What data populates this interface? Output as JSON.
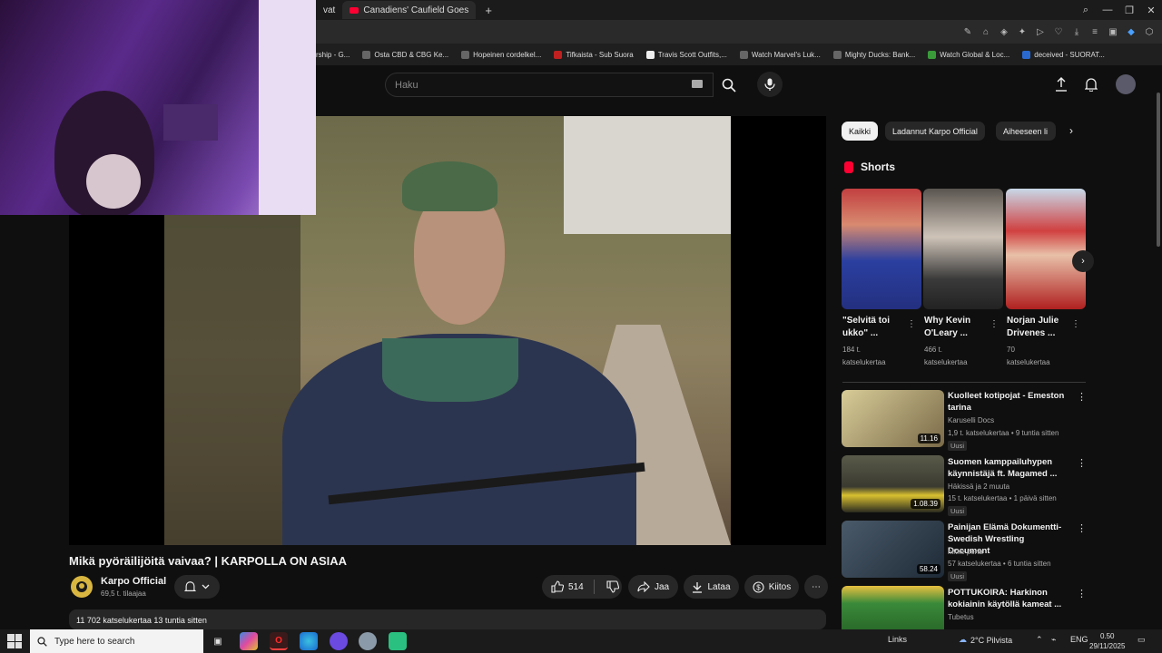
{
  "browser": {
    "tabs": [
      {
        "label": "vat"
      },
      {
        "label": "Canadiens' Caufield Goes"
      }
    ],
    "bookmarks": [
      "rship - G...",
      "Osta CBD & CBG Ke...",
      "Hopeinen cordelkel...",
      "Tifkaista - Sub Suora",
      "Travis Scott Outfits,...",
      "Watch Marvel's Luk...",
      "Mighty Ducks: Bank...",
      "Watch Global & Loc...",
      "deceived - SUORAT..."
    ]
  },
  "header": {
    "search_placeholder": "Haku"
  },
  "video": {
    "title": "Mikä pyöräilijöitä vaivaa? | KARPOLLA ON ASIAA",
    "channel_name": "Karpo Official",
    "subscribers": "69,5 t. tilaajaa",
    "likes": "514",
    "share_label": "Jaa",
    "download_label": "Lataa",
    "thanks_label": "Kiitos",
    "views_time": "11 702 katselukertaa  13 tuntia sitten"
  },
  "chips": [
    "Kaikki",
    "Ladannut Karpo Official",
    "Aiheeseen li"
  ],
  "shorts": {
    "heading": "Shorts",
    "items": [
      {
        "title_line1": "\"Selvitä toi",
        "title_line2": "ukko\" ...",
        "views1": "184 t.",
        "views2": "katselukertaa"
      },
      {
        "title_line1": "Why Kevin",
        "title_line2": "O'Leary ...",
        "views1": "466 t.",
        "views2": "katselukertaa"
      },
      {
        "title_line1": "Norjan Julie",
        "title_line2": "Drivenes ...",
        "views1": "70",
        "views2": "katselukertaa"
      }
    ]
  },
  "recommendations": [
    {
      "title": "Kuolleet kotipojat - Emeston tarina",
      "channel": "Karuselli Docs",
      "meta": "1,9 t. katselukertaa • 9 tuntia sitten",
      "badge": "Uusi",
      "duration": "11.16",
      "color": "#c7b98a"
    },
    {
      "title": "Suomen kamppailuhypen käynnistäjä ft. Magamed ...",
      "channel": "Häkissä ja 2 muuta",
      "meta": "15 t. katselukertaa • 1 päivä sitten",
      "badge": "Uusi",
      "duration": "1.08.39",
      "color": "#4a4a3a"
    },
    {
      "title": "Painijan Elämä Dokumentti- Swedish Wrestling Document",
      "channel": "nikke pena",
      "meta": "57 katselukertaa • 6 tuntia sitten",
      "badge": "Uusi",
      "duration": "58.24",
      "color": "#2e3a4a"
    },
    {
      "title": "POTTUKOIRA: Harkinon kokiainin käytöllä kameat ...",
      "channel": "Tubetus",
      "meta": "",
      "badge": "",
      "duration": "",
      "color": "#3a7a3a"
    }
  ],
  "taskbar": {
    "search_placeholder": "Type here to search",
    "links": "Links",
    "weather": "2°C Pilvista",
    "lang": "ENG",
    "time": "0.50",
    "date": "29/11/2025"
  }
}
